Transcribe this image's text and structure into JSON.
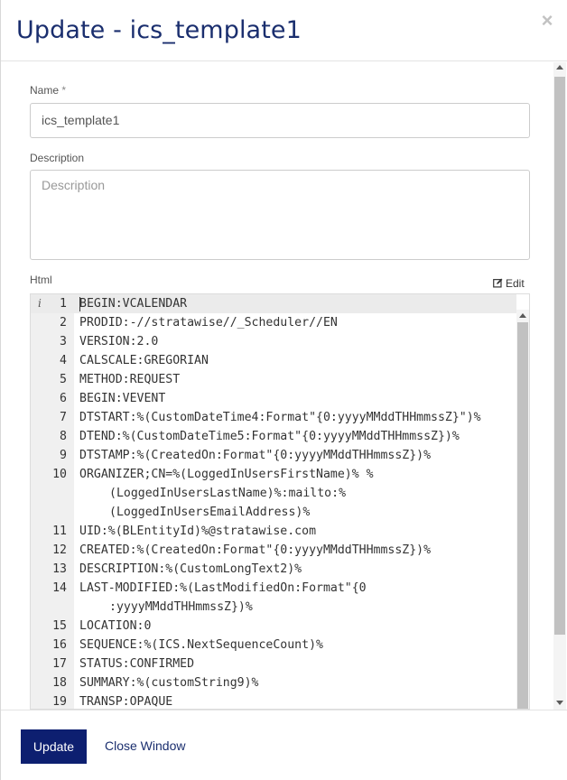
{
  "dialog": {
    "title": "Update - ics_template1",
    "close_icon": "×"
  },
  "form": {
    "name_label": "Name",
    "name_required": "*",
    "name_value": "ics_template1",
    "description_label": "Description",
    "description_placeholder": "Description",
    "html_label": "Html",
    "edit_label": "Edit"
  },
  "editor": {
    "info_icon": "i",
    "lines": [
      {
        "num": "1",
        "text": "BEGIN:VCALENDAR"
      },
      {
        "num": "2",
        "text": "PRODID:-//stratawise//_Scheduler//EN"
      },
      {
        "num": "3",
        "text": "VERSION:2.0"
      },
      {
        "num": "4",
        "text": "CALSCALE:GREGORIAN"
      },
      {
        "num": "5",
        "text": "METHOD:REQUEST"
      },
      {
        "num": "6",
        "text": "BEGIN:VEVENT"
      },
      {
        "num": "7",
        "text": "DTSTART:%(CustomDateTime4:Format\"{0:yyyyMMddTHHmmssZ}\")%"
      },
      {
        "num": "8",
        "text": "DTEND:%(CustomDateTime5:Format\"{0:yyyyMMddTHHmmssZ})%"
      },
      {
        "num": "9",
        "text": "DTSTAMP:%(CreatedOn:Format\"{0:yyyyMMddTHHmmssZ})%"
      },
      {
        "num": "10",
        "text": "ORGANIZER;CN=%(LoggedInUsersFirstName)% %"
      },
      {
        "num": "",
        "text": "(LoggedInUsersLastName)%:mailto:%"
      },
      {
        "num": "",
        "text": "(LoggedInUsersEmailAddress)%"
      },
      {
        "num": "11",
        "text": "UID:%(BLEntityId)%@stratawise.com"
      },
      {
        "num": "12",
        "text": "CREATED:%(CreatedOn:Format\"{0:yyyyMMddTHHmmssZ})%"
      },
      {
        "num": "13",
        "text": "DESCRIPTION:%(CustomLongText2)%"
      },
      {
        "num": "14",
        "text": "LAST-MODIFIED:%(LastModifiedOn:Format\"{0"
      },
      {
        "num": "",
        "text": ":yyyyMMddTHHmmssZ})%"
      },
      {
        "num": "15",
        "text": "LOCATION:0"
      },
      {
        "num": "16",
        "text": "SEQUENCE:%(ICS.NextSequenceCount)%"
      },
      {
        "num": "17",
        "text": "STATUS:CONFIRMED"
      },
      {
        "num": "18",
        "text": "SUMMARY:%(customString9)%"
      },
      {
        "num": "19",
        "text": "TRANSP:OPAQUE"
      }
    ]
  },
  "footer": {
    "update_label": "Update",
    "close_window_label": "Close Window"
  }
}
